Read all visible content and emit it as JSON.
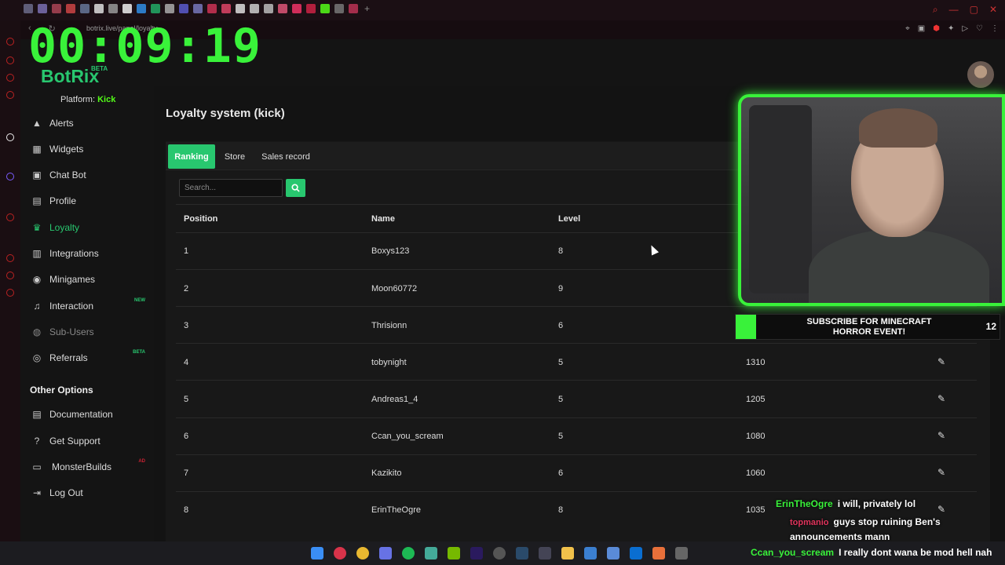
{
  "browser": {
    "url": "botrix.live/panel/loyalty"
  },
  "stream": {
    "timer": "00:09:19"
  },
  "brand": {
    "name": "BotRix",
    "badge": "BETA"
  },
  "platform": {
    "label": "Platform:",
    "value": "Kick"
  },
  "sidebar": {
    "items": [
      {
        "label": "Alerts",
        "icon": "bell-icon"
      },
      {
        "label": "Widgets",
        "icon": "grid-icon"
      },
      {
        "label": "Chat Bot",
        "icon": "robot-icon"
      },
      {
        "label": "Profile",
        "icon": "id-card-icon"
      },
      {
        "label": "Loyalty",
        "icon": "trophy-icon"
      },
      {
        "label": "Integrations",
        "icon": "integration-icon"
      },
      {
        "label": "Minigames",
        "icon": "gamepad-icon"
      },
      {
        "label": "Interaction",
        "icon": "music-icon",
        "tag": "NEW"
      },
      {
        "label": "Sub-Users",
        "icon": "users-icon"
      },
      {
        "label": "Referrals",
        "icon": "referral-icon",
        "tag": "BETA"
      }
    ],
    "other_heading": "Other Options",
    "other_items": [
      {
        "label": "Documentation",
        "icon": "book-icon"
      },
      {
        "label": "Get Support",
        "icon": "help-icon"
      },
      {
        "label": "MonsterBuilds",
        "icon": "laptop-icon",
        "tag": "AD"
      },
      {
        "label": "Log Out",
        "icon": "logout-icon"
      }
    ]
  },
  "page": {
    "title": "Loyalty system (kick)"
  },
  "tabs": [
    "Ranking",
    "Store",
    "Sales record"
  ],
  "search": {
    "placeholder": "Search..."
  },
  "table": {
    "headers": [
      "Position",
      "Name",
      "Level"
    ],
    "rows": [
      {
        "position": "1",
        "name": "Boxys123",
        "level": "8",
        "points": ""
      },
      {
        "position": "2",
        "name": "Moon60772",
        "level": "9",
        "points": ""
      },
      {
        "position": "3",
        "name": "Thrisionn",
        "level": "6",
        "points": ""
      },
      {
        "position": "4",
        "name": "tobynight",
        "level": "5",
        "points": "1310"
      },
      {
        "position": "5",
        "name": "Andreas1_4",
        "level": "5",
        "points": "1205"
      },
      {
        "position": "6",
        "name": "Ccan_you_scream",
        "level": "5",
        "points": "1080"
      },
      {
        "position": "7",
        "name": "Kazikito",
        "level": "6",
        "points": "1060"
      },
      {
        "position": "8",
        "name": "ErinTheOgre",
        "level": "8",
        "points": "1035"
      }
    ]
  },
  "overlay": {
    "banner_text": "SUBSCRIBE FOR MINECRAFT HORROR EVENT!",
    "banner_count": "12",
    "chat": [
      {
        "user": "ErinTheOgre",
        "message": "i will, privately lol"
      },
      {
        "user": "topmanio",
        "message": "guys stop ruining Ben's announcements mann"
      }
    ],
    "bottom_chat": {
      "user": "Ccan_you_scream",
      "message": "I really dont wana be mod hell nah"
    }
  },
  "colors": {
    "accent": "#28c76f",
    "kick": "#53fc18",
    "overlay_green": "#39f23a"
  }
}
